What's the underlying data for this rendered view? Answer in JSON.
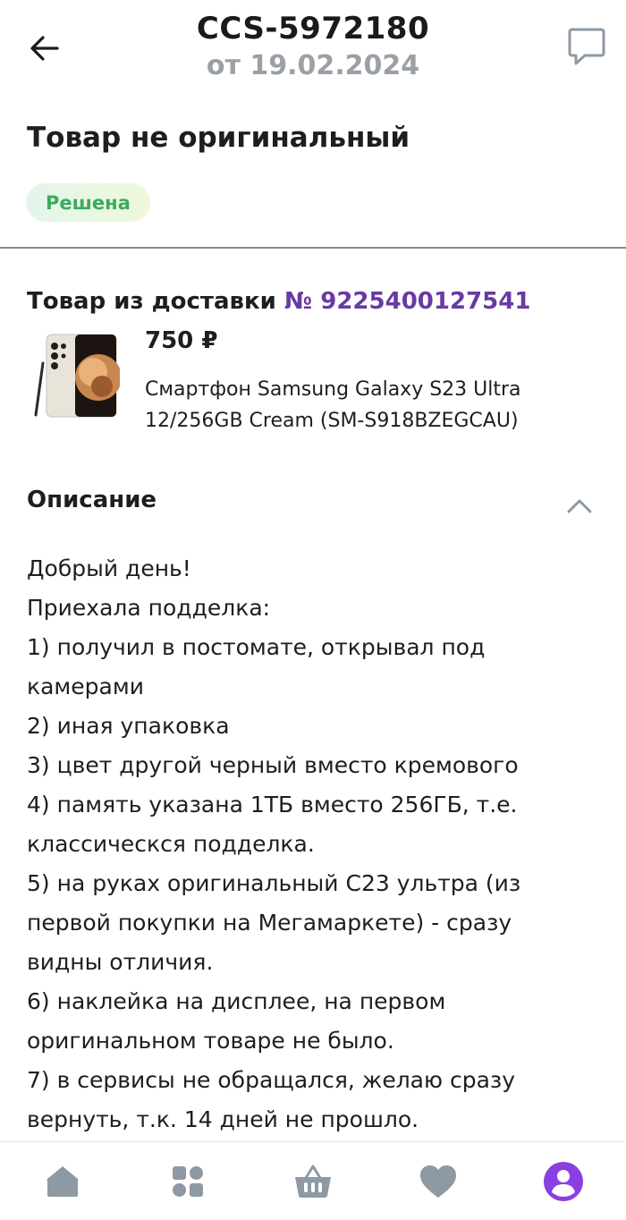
{
  "header": {
    "claim_number": "CCS-5972180",
    "claim_date": "от 19.02.2024",
    "back_icon": "arrow-left-icon",
    "chat_icon": "chat-bubble-icon"
  },
  "claim": {
    "title": "Товар не оригинальный",
    "status": "Решена",
    "status_color": "#3daa5f"
  },
  "product": {
    "delivery_label": "Товар из доставки",
    "delivery_number": "№ 9225400127541",
    "delivery_link_color": "#6a3aa2",
    "price": "750 ₽",
    "name_lines": [
      "Смартфон Samsung Galaxy S23 Ultra",
      "12/256GB Cream (SM-S918BZEGCAU)"
    ]
  },
  "description": {
    "header": "Описание",
    "toggle_icon": "chevron-up-icon",
    "lines": [
      "Добрый день!",
      "Приехала подделка:",
      "1) получил в постомате, открывал под",
      "камерами",
      "2) иная упаковка",
      "3) цвет другой черный вместо кремового",
      "4) память указана 1ТБ вместо 256ГБ, т.е.",
      "классическся подделка.",
      "5) на руках оригинальный С23 ультра (из",
      "первой покупки на Мегамаркете) - сразу",
      "видны отличия.",
      "6) наклейка на дисплее, на первом",
      "оригинальном товаре не было.",
      "7) в сервисы не обращался, желаю сразу",
      "вернуть, т.к. 14 дней не прошло."
    ]
  },
  "bottom_nav": {
    "items": [
      {
        "icon": "home-icon",
        "active": false
      },
      {
        "icon": "catalog-icon",
        "active": false
      },
      {
        "icon": "basket-icon",
        "active": false
      },
      {
        "icon": "heart-icon",
        "active": false
      },
      {
        "icon": "profile-icon",
        "active": true
      }
    ],
    "inactive_color": "#8e99a3",
    "active_color": "#8a3fe0"
  }
}
